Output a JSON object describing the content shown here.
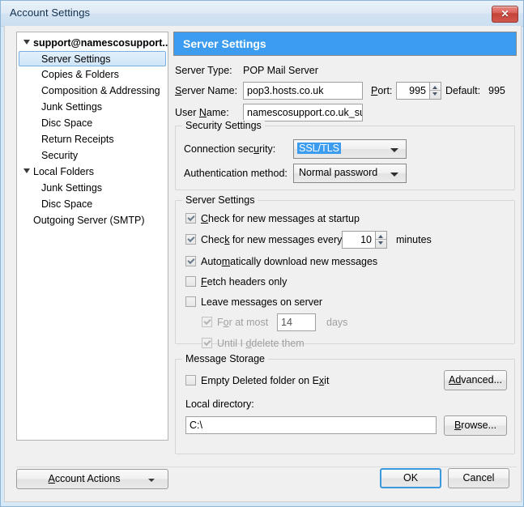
{
  "window": {
    "title": "Account Settings",
    "close_label": "✕",
    "accent_blue": "#3b9cf0",
    "frame_color": "#d7e8f7"
  },
  "sidebar": {
    "items": [
      {
        "label": "support@namescosupport....",
        "level": "account",
        "twisty": true,
        "selected": false
      },
      {
        "label": "Server Settings",
        "level": "child",
        "twisty": false,
        "selected": true
      },
      {
        "label": "Copies & Folders",
        "level": "child",
        "twisty": false,
        "selected": false
      },
      {
        "label": "Composition & Addressing",
        "level": "child",
        "twisty": false,
        "selected": false
      },
      {
        "label": "Junk Settings",
        "level": "child",
        "twisty": false,
        "selected": false
      },
      {
        "label": "Disc Space",
        "level": "child",
        "twisty": false,
        "selected": false
      },
      {
        "label": "Return Receipts",
        "level": "child",
        "twisty": false,
        "selected": false
      },
      {
        "label": "Security",
        "level": "child",
        "twisty": false,
        "selected": false
      },
      {
        "label": "Local Folders",
        "level": "group",
        "twisty": true,
        "selected": false
      },
      {
        "label": "Junk Settings",
        "level": "child",
        "twisty": false,
        "selected": false
      },
      {
        "label": "Disc Space",
        "level": "child",
        "twisty": false,
        "selected": false
      },
      {
        "label": "Outgoing Server (SMTP)",
        "level": "root",
        "twisty": false,
        "selected": false
      }
    ],
    "account_actions_label": "Account Actions"
  },
  "pane": {
    "header": "Server Settings",
    "server_type_label": "Server Type:",
    "server_type_value": "POP Mail Server",
    "server_name_label": "Server Name:",
    "server_name_value": "pop3.hosts.co.uk",
    "port_label": "Port:",
    "port_value": "995",
    "port_default_label": "Default:",
    "port_default_value": "995",
    "user_name_label": "User Name:",
    "user_name_value": "namescosupport.co.uk_su"
  },
  "security_settings": {
    "title": "Security Settings",
    "connection_security_label": "Connection security:",
    "connection_security_value": "SSL/TLS",
    "authentication_method_label": "Authentication method:",
    "authentication_method_value": "Normal password"
  },
  "server_settings": {
    "title": "Server Settings",
    "check_startup": {
      "label": "Check for new messages at startup",
      "checked": true,
      "disabled": false
    },
    "check_every": {
      "label": "Check for new messages every",
      "checked": true,
      "disabled": false
    },
    "check_every_value": "10",
    "minutes_label": "minutes",
    "auto_download": {
      "label": "Automatically download new messages",
      "checked": true,
      "disabled": false
    },
    "fetch_headers": {
      "label": "Fetch headers only",
      "checked": false,
      "disabled": false
    },
    "leave_on_server": {
      "label": "Leave messages on server",
      "checked": false,
      "disabled": false
    },
    "for_at_most": {
      "label": "For at most",
      "checked": true,
      "disabled": true
    },
    "for_at_most_value": "14",
    "days_label": "days",
    "until_delete": {
      "label": "Until I delete them",
      "checked": true,
      "disabled": true
    }
  },
  "message_storage": {
    "title": "Message Storage",
    "empty_deleted": {
      "label": "Empty Deleted folder on Exit",
      "checked": false,
      "disabled": false
    },
    "advanced_label": "Advanced...",
    "local_directory_label": "Local directory:",
    "local_directory_value": "C:\\",
    "browse_label": "Browse..."
  },
  "footer": {
    "ok_label": "OK",
    "cancel_label": "Cancel"
  }
}
